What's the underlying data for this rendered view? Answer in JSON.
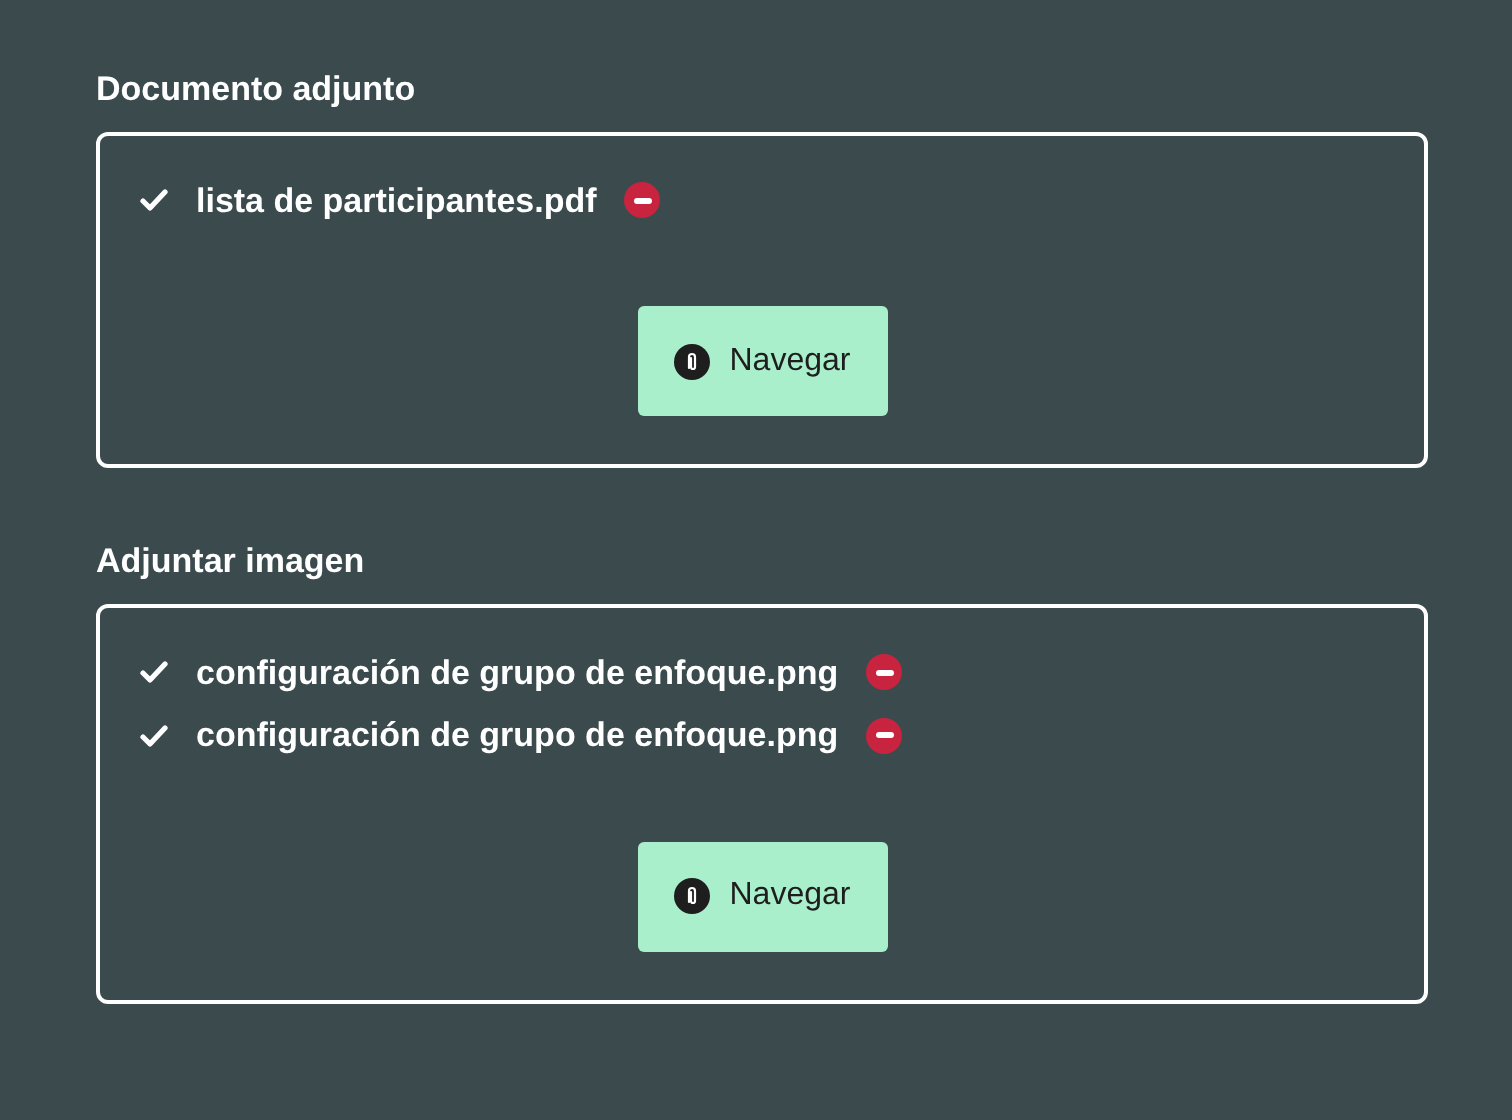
{
  "sections": [
    {
      "title": "Documento adjunto",
      "files": [
        {
          "name": "lista de participantes.pdf"
        }
      ],
      "button": "Navegar"
    },
    {
      "title": "Adjuntar imagen",
      "files": [
        {
          "name": "configuración de grupo de enfoque.png"
        },
        {
          "name": "configuración de grupo de enfoque.png"
        }
      ],
      "button": "Navegar"
    }
  ]
}
